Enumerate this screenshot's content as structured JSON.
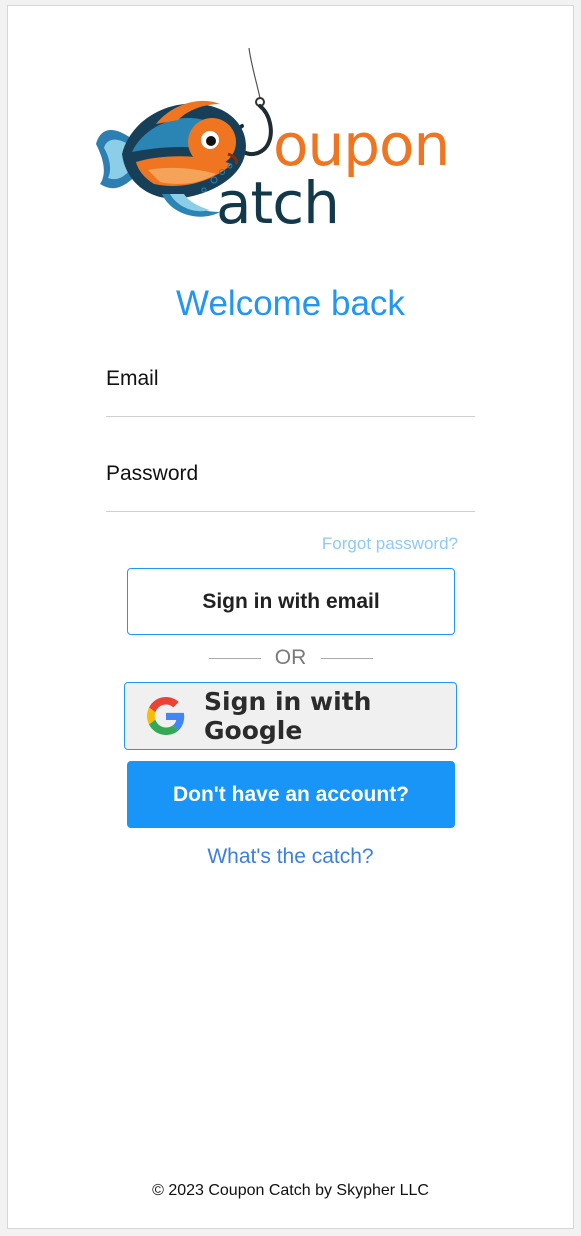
{
  "brand": {
    "word_top": "oupon",
    "word_bottom": "atch",
    "icon": "fish-logo-icon",
    "primary_color": "#2196f3",
    "accent_color": "#ef7521",
    "dark_color": "#12384a"
  },
  "title": "Welcome back",
  "form": {
    "email_label": "Email",
    "password_label": "Password",
    "forgot_label": "Forgot password?"
  },
  "buttons": {
    "sign_in_email": "Sign in with email",
    "or_label": "OR",
    "sign_in_google": "Sign in with Google",
    "google_icon": "google-g-icon",
    "signup": "Don't have an account?"
  },
  "links": {
    "whats_the_catch": "What's the catch?"
  },
  "footer": {
    "copyright": "© 2023 Coupon Catch by Skypher LLC"
  }
}
